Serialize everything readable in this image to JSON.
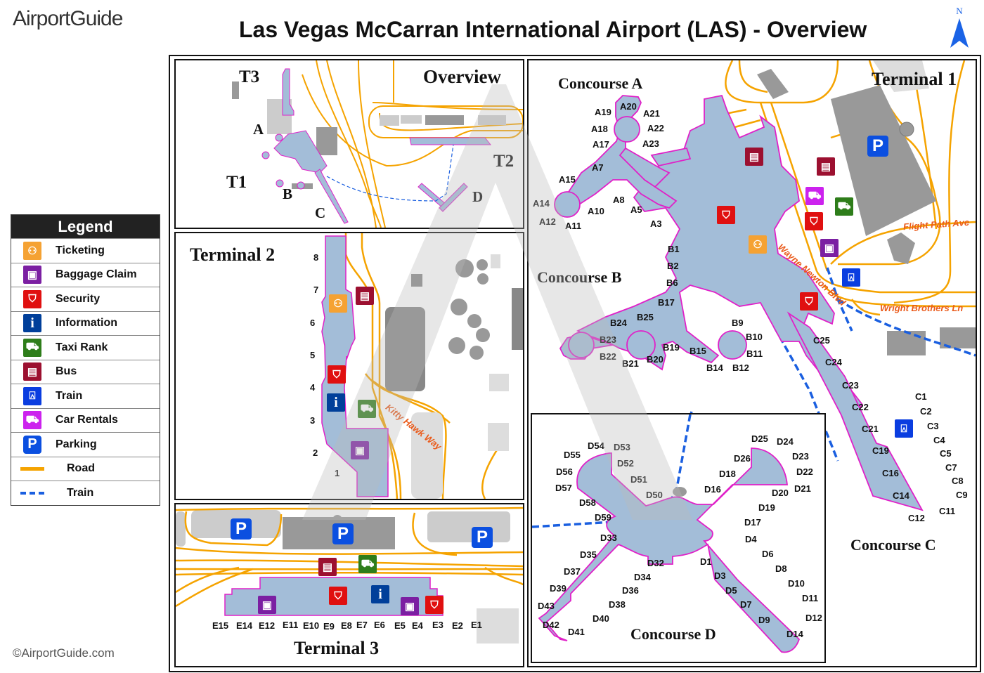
{
  "header": {
    "logo_text": "AirportGuide",
    "title": "Las Vegas McCarran International Airport (LAS) - Overview",
    "north_label": "N",
    "copyright": "©AirportGuide.com"
  },
  "colors": {
    "terminal_fill": "#a3bdd8",
    "terminal_outline": "#e020c8",
    "road": "#f5a300",
    "train_line": "#1a5fe0",
    "ticketing": "#f5a233",
    "baggage": "#7b1fa2",
    "security": "#e01010",
    "information": "#003f9a",
    "taxi": "#2e7d1a",
    "bus": "#9c1030",
    "train": "#0a3de0",
    "car_rentals": "#cc22ee",
    "parking": "#0b4fe0",
    "street_label": "#ea5a1a"
  },
  "legend": {
    "title": "Legend",
    "items": [
      {
        "label": "Ticketing",
        "icon": "ticketing-icon"
      },
      {
        "label": "Baggage Claim",
        "icon": "baggage-claim-icon"
      },
      {
        "label": "Security",
        "icon": "security-icon"
      },
      {
        "label": "Information",
        "icon": "information-icon"
      },
      {
        "label": "Taxi Rank",
        "icon": "taxi-icon"
      },
      {
        "label": "Bus",
        "icon": "bus-icon"
      },
      {
        "label": "Train",
        "icon": "train-icon"
      },
      {
        "label": "Car Rentals",
        "icon": "car-rental-icon"
      },
      {
        "label": "Parking",
        "icon": "parking-icon"
      },
      {
        "label": "Road",
        "icon": "road-line"
      },
      {
        "label": "Train",
        "icon": "train-line"
      }
    ]
  },
  "overview": {
    "title": "Overview",
    "labels": {
      "t1": "T1",
      "t2": "T2",
      "t3": "T3",
      "a": "A",
      "b": "B",
      "c": "C",
      "d": "D"
    }
  },
  "terminal2": {
    "title": "Terminal 2",
    "gates": [
      "8",
      "7",
      "6",
      "5",
      "4",
      "3",
      "2",
      "1"
    ],
    "street": "Kitty Hawk Way"
  },
  "terminal3": {
    "title": "Terminal 3",
    "gates": [
      "E15",
      "E14",
      "E12",
      "E11",
      "E10",
      "E9",
      "E8",
      "E7",
      "E6",
      "E5",
      "E4",
      "E3",
      "E2",
      "E1"
    ]
  },
  "terminal1": {
    "title": "Terminal 1",
    "streets": {
      "flight_path": "Flight Path Ave",
      "wayne_newton": "Wayne Newton Blvd",
      "wright_brothers": "Wright Brothers Ln"
    }
  },
  "concourse_a": {
    "title": "Concourse A",
    "gates": [
      "A19",
      "A20",
      "A21",
      "A18",
      "A22",
      "A17",
      "A23",
      "A7",
      "A15",
      "A8",
      "A14",
      "A10",
      "A5",
      "A12",
      "A11",
      "A3"
    ]
  },
  "concourse_b": {
    "title": "Concourse B",
    "gates": [
      "B1",
      "B2",
      "B6",
      "B17",
      "B24",
      "B25",
      "B9",
      "B23",
      "B10",
      "B19",
      "B15",
      "B11",
      "B22",
      "B21",
      "B20",
      "B14",
      "B12"
    ]
  },
  "concourse_c": {
    "title": "Concourse C",
    "gates": [
      "C25",
      "C24",
      "C23",
      "C22",
      "C21",
      "C19",
      "C16",
      "C14",
      "C12",
      "C1",
      "C2",
      "C3",
      "C4",
      "C5",
      "C7",
      "C8",
      "C9",
      "C11"
    ]
  },
  "concourse_d": {
    "title": "Concourse D",
    "gates": [
      "D54",
      "D53",
      "D55",
      "D52",
      "D56",
      "D51",
      "D57",
      "D50",
      "D58",
      "D59",
      "D33",
      "D35",
      "D37",
      "D39",
      "D43",
      "D42",
      "D41",
      "D40",
      "D38",
      "D36",
      "D34",
      "D32",
      "D1",
      "D3",
      "D5",
      "D7",
      "D9",
      "D14",
      "D12",
      "D11",
      "D10",
      "D8",
      "D6",
      "D4",
      "D17",
      "D19",
      "D20",
      "D21",
      "D22",
      "D23",
      "D24",
      "D25",
      "D26",
      "D18",
      "D16"
    ]
  }
}
